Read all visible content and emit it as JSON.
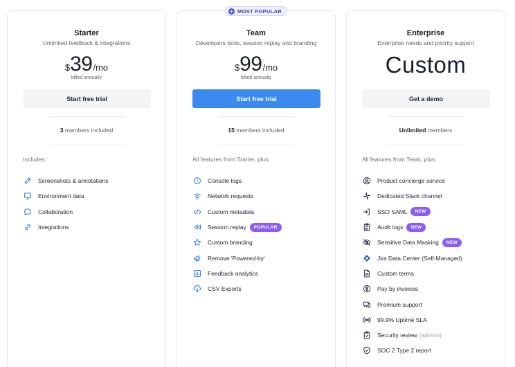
{
  "plans": {
    "starter": {
      "name": "Starter",
      "description": "Unlimited feedback & integrations",
      "currency": "$",
      "amount": "39",
      "period": "/mo",
      "billing": "billed annually",
      "cta": "Start free trial",
      "members_count": "3",
      "members_text": "members included",
      "includes_label": "Includes:",
      "features": [
        {
          "label": "Screenshots & annotations",
          "icon": "pencil-icon"
        },
        {
          "label": "Environment data",
          "icon": "monitor-icon"
        },
        {
          "label": "Collaboration",
          "icon": "chat-bubble-icon"
        },
        {
          "label": "Integrations",
          "icon": "link-icon"
        }
      ]
    },
    "team": {
      "badge": "MOST POPULAR",
      "name": "Team",
      "description": "Developers tools, session replay and branding",
      "currency": "$",
      "amount": "99",
      "period": "/mo",
      "billing": "billed annually",
      "cta": "Start free trial",
      "members_count": "15",
      "members_text": "members included",
      "includes_label": "All features from Starter, plus:",
      "features": [
        {
          "label": "Console logs",
          "icon": "info-circle-icon"
        },
        {
          "label": "Network requests",
          "icon": "wifi-icon"
        },
        {
          "label": "Custom metadata",
          "icon": "code-icon"
        },
        {
          "label": "Session replay",
          "icon": "rewind-icon",
          "tag": "POPULAR"
        },
        {
          "label": "Custom branding",
          "icon": "star-icon"
        },
        {
          "label": "Remove 'Powered-by'",
          "icon": "megaphone-icon"
        },
        {
          "label": "Feedback analytics",
          "icon": "bar-chart-icon"
        },
        {
          "label": "CSV Exports",
          "icon": "cloud-download-icon"
        }
      ]
    },
    "enterprise": {
      "name": "Enterprise",
      "description": "Enterprise needs and priority support",
      "price_text": "Custom",
      "cta": "Get a demo",
      "members_count": "Unlimited",
      "members_text": "members",
      "includes_label": "All features from Team, plus:",
      "features": [
        {
          "label": "Product concierge service",
          "icon": "user-circle-icon"
        },
        {
          "label": "Dedicated Slack channel",
          "icon": "slack-icon"
        },
        {
          "label": "SSO SAML",
          "icon": "sign-in-icon",
          "tag": "NEW"
        },
        {
          "label": "Audit logs",
          "icon": "clipboard-icon",
          "tag": "NEW"
        },
        {
          "label": "Sensitive Data Masking",
          "icon": "eye-off-icon",
          "tag": "NEW"
        },
        {
          "label": "Jira Data Center (Self-Managed)",
          "icon": "jira-icon"
        },
        {
          "label": "Custom terms",
          "icon": "document-icon"
        },
        {
          "label": "Pay by invoices",
          "icon": "dollar-circle-icon"
        },
        {
          "label": "Premium support",
          "icon": "support-chat-icon"
        },
        {
          "label": "99.9% Uptime SLA",
          "icon": "signal-icon"
        },
        {
          "label": "Security review",
          "icon": "clipboard-check-icon",
          "addon": "(add-on)"
        },
        {
          "label": "SOC 2 Type 2 report",
          "icon": "shield-check-icon"
        }
      ]
    }
  },
  "colors": {
    "primary": "#3b8aef",
    "tag_purple": "#8b5cf6",
    "icon_blue": "#2f7fe6",
    "badge_bg": "#eef0ff"
  }
}
